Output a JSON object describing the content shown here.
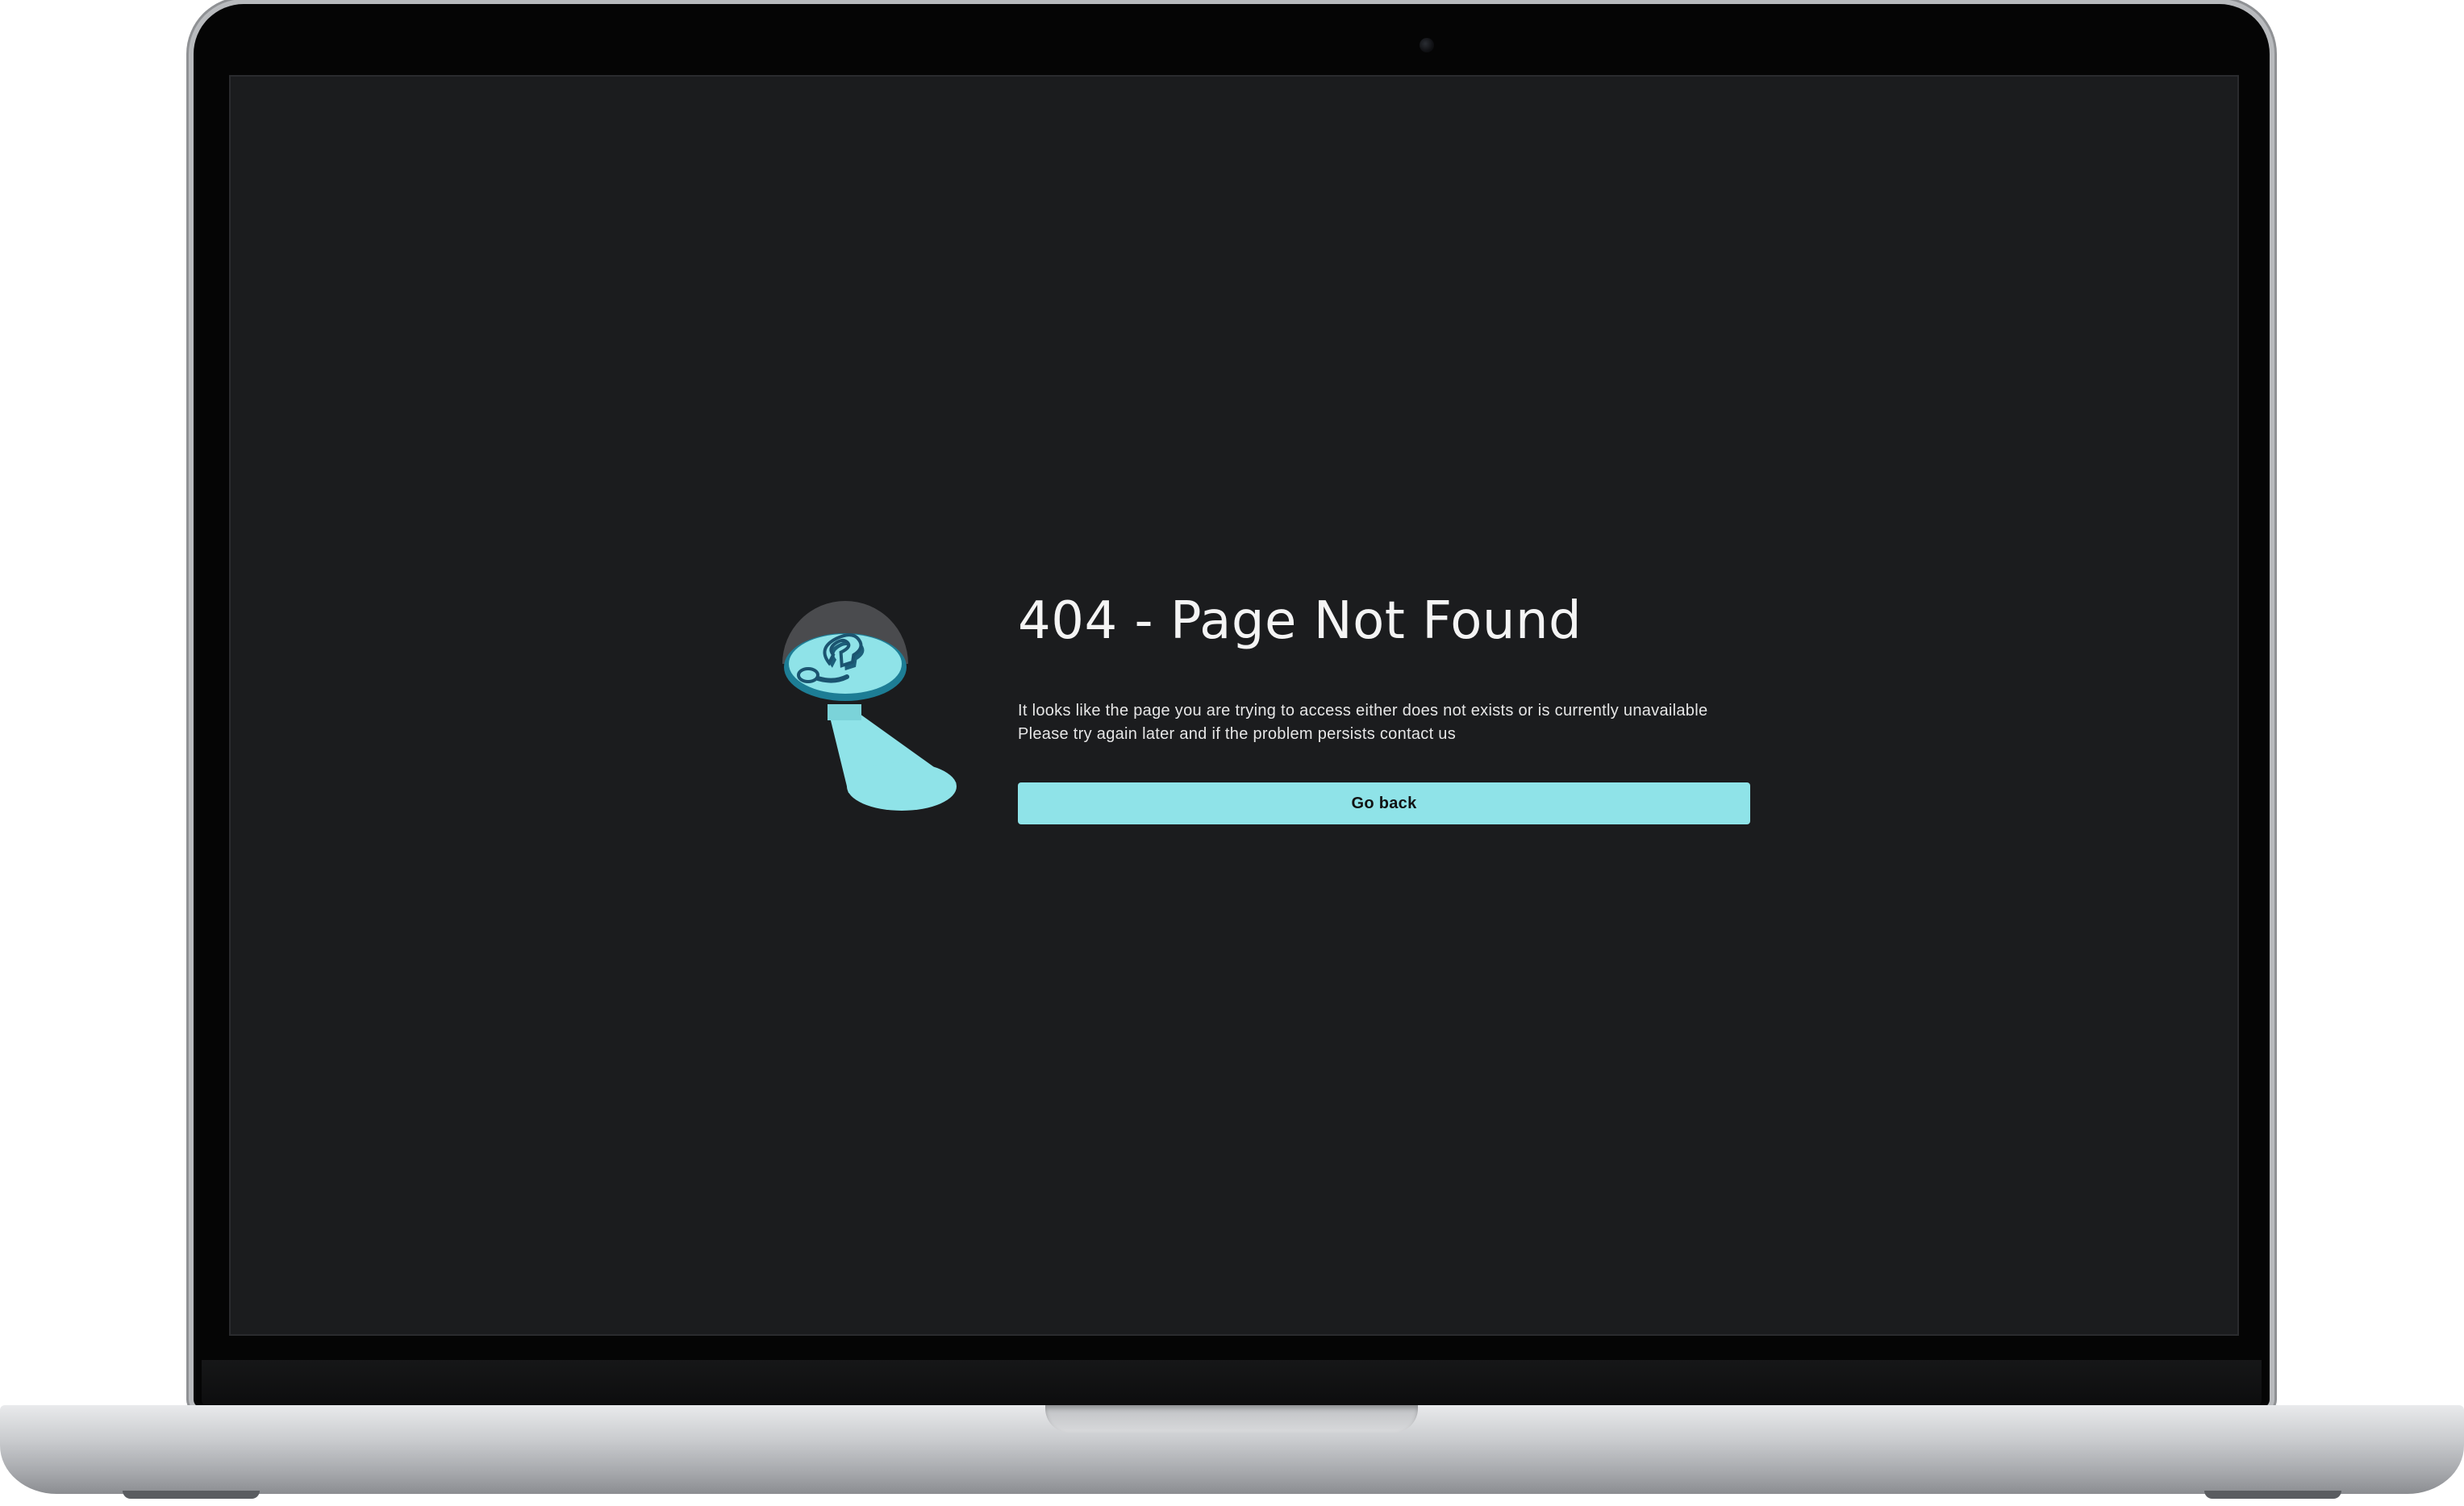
{
  "page": {
    "title": "404 - Page Not Found",
    "message_lines": [
      "It looks like the page you are trying to access either does not exists or is currently unavailable",
      "Please try again later and if the problem persists contact us"
    ],
    "go_back_label": "Go back"
  },
  "illustration": {
    "icon": "question-mark-spotlight-icon"
  },
  "colors": {
    "screen_background": "#1b1c1e",
    "accent": "#8fe3e8",
    "text": "#f4f4f4",
    "button_text": "#111213"
  }
}
